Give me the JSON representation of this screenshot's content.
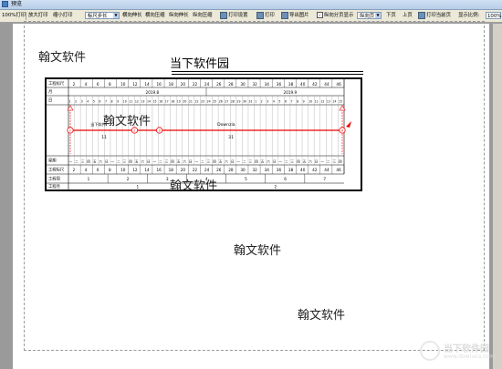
{
  "window": {
    "title": "预览"
  },
  "toolbar": {
    "zoom100_print": "100%打印",
    "zoom_in_print": "放大打印",
    "zoom_out_print": "缩小打印",
    "ruler_step_select": "标尺步长",
    "horizontal_stretch": "横向伸长",
    "horizontal_compress": "横向压缩",
    "vertical_stretch": "纵向伸长",
    "vertical_compress": "纵向压缩",
    "print_settings": "打印设置",
    "print": "打印",
    "export_image": "导出图片",
    "vertical_page_display": "纵向分页显示",
    "direction_select": "纵向页",
    "next_page": "下页",
    "prev_page": "上页",
    "print_current_page": "打印当前页",
    "display_ratio_label": "显示比例:",
    "display_ratio_value": "100%"
  },
  "page": {
    "watermarks": [
      "翰文软件",
      "翰文软件",
      "翰文软件",
      "翰文软件",
      "翰文软件"
    ],
    "title": "当下软件园"
  },
  "chart_data": {
    "type": "table",
    "row_labels": [
      "工程标尺",
      "月",
      "日",
      "星期",
      "工程标尺",
      "工程周",
      "工程月"
    ],
    "months": [
      "2019.8",
      "2019.9"
    ],
    "scale_numbers": [
      "2",
      "4",
      "6",
      "8",
      "10",
      "12",
      "14",
      "16",
      "18",
      "20",
      "22",
      "24",
      "26",
      "28",
      "30",
      "32",
      "34",
      "36",
      "38",
      "40",
      "42",
      "44",
      "46"
    ],
    "tasks": [
      {
        "name": "当下软件",
        "duration": "11"
      },
      {
        "name": "Downzia",
        "duration": "31"
      }
    ],
    "nodes": [
      "1",
      "2",
      "3",
      "4"
    ],
    "week_numbers": [
      "1",
      "2",
      "3",
      "4",
      "5",
      "6",
      "7"
    ],
    "month_numbers": [
      "1",
      "2"
    ]
  },
  "logo": {
    "text": "当下软件园",
    "sub": "www.downxia.com"
  }
}
